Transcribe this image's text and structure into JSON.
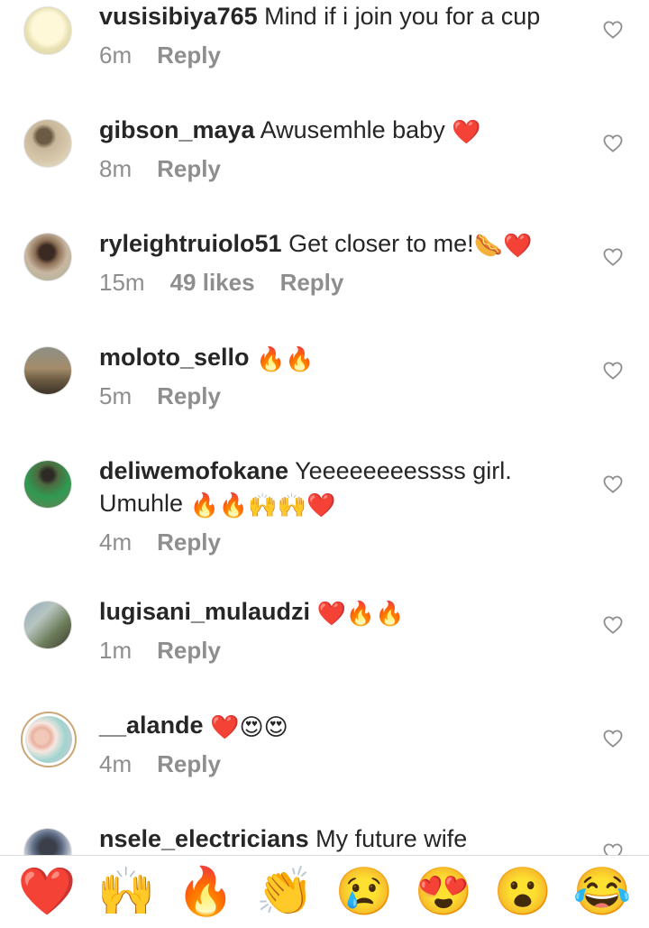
{
  "comments": [
    {
      "user": "vusisibiya765",
      "text": "Mind if i join you for a cup",
      "time": "6m",
      "likes": "",
      "reply": "Reply"
    },
    {
      "user": "gibson_maya",
      "text": "Awusemhle baby",
      "emoji": "❤️",
      "time": "8m",
      "likes": "",
      "reply": "Reply"
    },
    {
      "user": "ryleightruiolo51",
      "text": "Get closer to me!",
      "emoji": "🌭❤️",
      "time": "15m",
      "likes": "49 likes",
      "reply": "Reply"
    },
    {
      "user": "moloto_sello",
      "text": "",
      "emoji": "🔥🔥",
      "time": "5m",
      "likes": "",
      "reply": "Reply"
    },
    {
      "user": "deliwemofokane",
      "text": "Yeeeeeeeessss girl. Umuhle",
      "emoji": "🔥🔥🙌🙌❤️",
      "time": "4m",
      "likes": "",
      "reply": "Reply"
    },
    {
      "user": "lugisani_mulaudzi",
      "text": "",
      "emoji": "❤️🔥🔥",
      "time": "1m",
      "likes": "",
      "reply": "Reply"
    },
    {
      "user": "__alande",
      "text": "",
      "emoji": "❤️😍😍",
      "time": "4m",
      "likes": "",
      "reply": "Reply"
    },
    {
      "user": "nsele_electricians",
      "text": "My future wife",
      "time": "",
      "likes": "",
      "reply": ""
    }
  ],
  "quick_reactions": [
    "❤️",
    "🙌",
    "🔥",
    "👏",
    "😢",
    "😍",
    "😮",
    "😂"
  ],
  "colors": {
    "text": "#262626",
    "meta": "#8e8e8e",
    "divider": "#dbdbdb",
    "like_outline": "#8e8e8e"
  }
}
